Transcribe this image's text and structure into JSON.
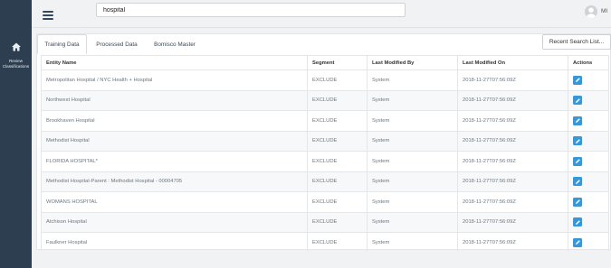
{
  "sidebar": {
    "items": [
      {
        "icon": "home-icon",
        "label_line1": "Review",
        "label_line2": "Classifications"
      }
    ],
    "background": "#2c3e50"
  },
  "header": {
    "search_value": "hospital",
    "user_name": "MI"
  },
  "tabs": [
    {
      "label": "Training Data",
      "active": true
    },
    {
      "label": "Processed Data",
      "active": false
    },
    {
      "label": "Bomisco Master",
      "active": false
    }
  ],
  "recent_search_label": "Recent Search List...",
  "table": {
    "columns": [
      "Entity Name",
      "Segment",
      "Last Modified By",
      "Last Modified On",
      "Actions"
    ],
    "rows": [
      {
        "entity": "Metropolitan Hospital / NYC Health + Hospital",
        "segment": "EXCLUDE",
        "modified_by": "System",
        "modified_on": "2018-11-27T07:56:09Z"
      },
      {
        "entity": "Northwest Hospital",
        "segment": "EXCLUDE",
        "modified_by": "System",
        "modified_on": "2018-11-27T07:56:09Z"
      },
      {
        "entity": "Brookhaven Hospital",
        "segment": "EXCLUDE",
        "modified_by": "System",
        "modified_on": "2018-11-27T07:56:09Z"
      },
      {
        "entity": "Methodist Hospital",
        "segment": "EXCLUDE",
        "modified_by": "System",
        "modified_on": "2018-11-27T07:56:09Z"
      },
      {
        "entity": "FLORIDA HOSPITAL*",
        "segment": "EXCLUDE",
        "modified_by": "System",
        "modified_on": "2018-11-27T07:56:09Z"
      },
      {
        "entity": "Methodist Hospital-Parent : Methodist Hospital - 00004705",
        "segment": "EXCLUDE",
        "modified_by": "System",
        "modified_on": "2018-11-27T07:56:09Z"
      },
      {
        "entity": "WOMANS HOSPITAL",
        "segment": "EXCLUDE",
        "modified_by": "System",
        "modified_on": "2018-11-27T07:56:09Z"
      },
      {
        "entity": "Atchison Hospital",
        "segment": "EXCLUDE",
        "modified_by": "System",
        "modified_on": "2018-11-27T07:56:09Z"
      },
      {
        "entity": "Faulkner Hospital",
        "segment": "EXCLUDE",
        "modified_by": "System",
        "modified_on": "2018-11-27T07:56:09Z"
      }
    ],
    "action_icon": "pencil-icon",
    "action_color": "#3498db"
  }
}
